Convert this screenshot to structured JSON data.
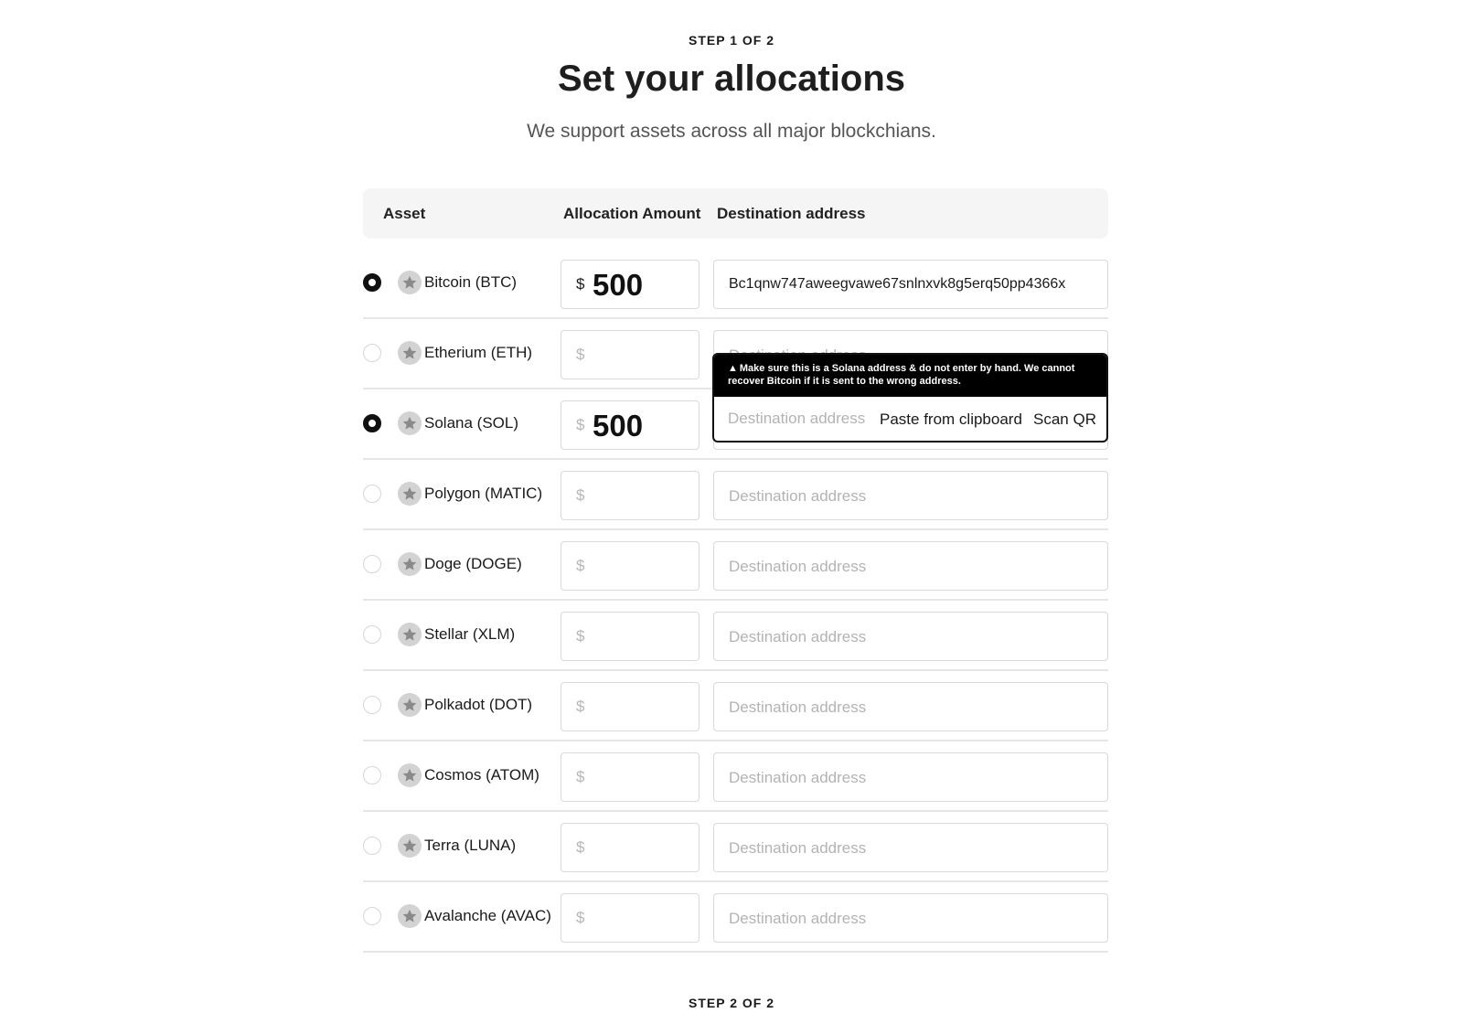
{
  "header": {
    "step_label": "STEP 1 OF 2",
    "title": "Set your allocations",
    "subtitle": "We support assets across all major blockchians."
  },
  "table": {
    "columns": [
      "Asset",
      "Allocation Amount",
      "Destination address"
    ],
    "currency_symbol": "$",
    "dest_placeholder": "Destination address",
    "rows": [
      {
        "asset": "Bitcoin (BTC)",
        "selected": true,
        "amount": "500",
        "address": "Bc1qnw747aweegvawe67snlnxvk8g5erq50pp4366x"
      },
      {
        "asset": "Etherium (ETH)",
        "selected": false,
        "amount": "",
        "address": ""
      },
      {
        "asset": "Solana (SOL)",
        "selected": true,
        "amount": "500",
        "address": ""
      },
      {
        "asset": "Polygon (MATIC)",
        "selected": false,
        "amount": "",
        "address": ""
      },
      {
        "asset": "Doge (DOGE)",
        "selected": false,
        "amount": "",
        "address": ""
      },
      {
        "asset": "Stellar (XLM)",
        "selected": false,
        "amount": "",
        "address": ""
      },
      {
        "asset": "Polkadot (DOT)",
        "selected": false,
        "amount": "",
        "address": ""
      },
      {
        "asset": "Cosmos (ATOM)",
        "selected": false,
        "amount": "",
        "address": ""
      },
      {
        "asset": "Terra (LUNA)",
        "selected": false,
        "amount": "",
        "address": ""
      },
      {
        "asset": "Avalanche (AVAC)",
        "selected": false,
        "amount": "",
        "address": ""
      }
    ]
  },
  "popup": {
    "warning_icon": "warning-triangle-icon",
    "warning": "Make sure this is a Solana address & do not enter by hand. We cannot recover Bitcoin if it is sent to the wrong address.",
    "placeholder": "Destination address",
    "paste_label": "Paste from clipboard",
    "scan_label": "Scan QR"
  },
  "footer": {
    "step_label": "STEP 2 OF 2"
  },
  "colors": {
    "accent": "#111111",
    "header_bg": "#f5f5f5",
    "placeholder": "#b3b3b3",
    "coin_icon_bg": "#d3d3d3"
  }
}
